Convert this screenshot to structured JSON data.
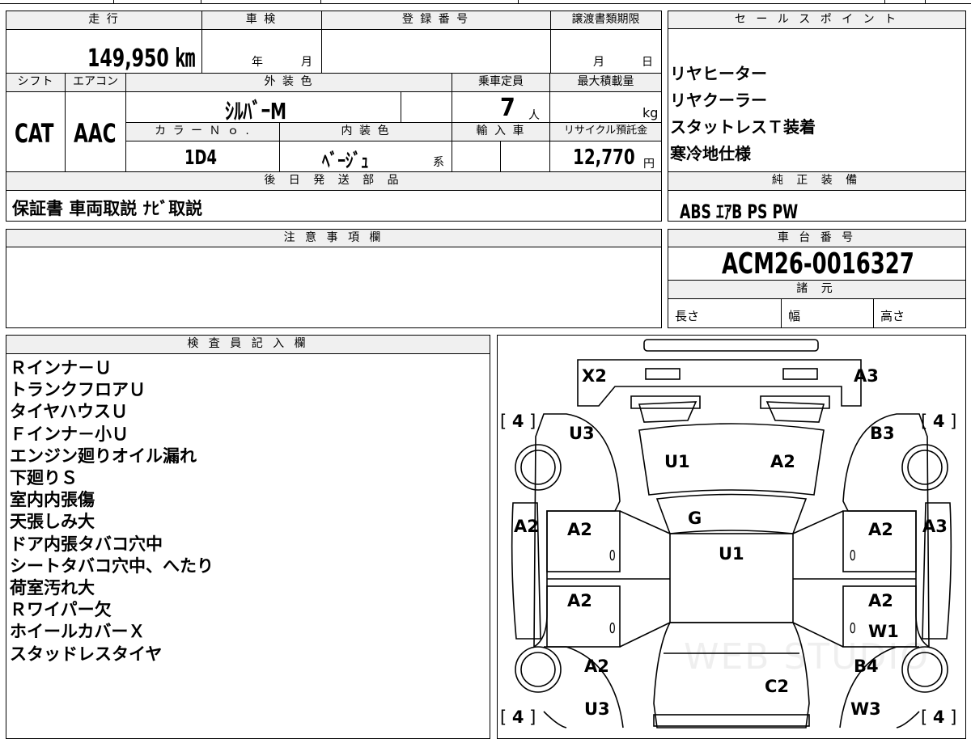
{
  "top_info": {
    "mileage_label": "走 行",
    "mileage": "149,950 ㎞",
    "inspection_label": "車 検",
    "inspection_year": "年",
    "inspection_month": "月",
    "registration_label": "登 録 番 号",
    "transfer_label": "譲渡書類期限",
    "transfer_month": "月",
    "transfer_day": "日",
    "shift_label": "シフト",
    "shift": "CAT",
    "ac_label": "エアコン",
    "ac": "AAC",
    "exterior_label": "外 装 色",
    "exterior": "ｼﾙﾊﾞｰM",
    "capacity_label": "乗車定員",
    "capacity": "7",
    "capacity_unit": "人",
    "max_load_label": "最大積載量",
    "max_load_unit": "kg",
    "color_no_label": "カ ラ ー Ｎ ｏ .",
    "color_no": "1D4",
    "interior_label": "内 装 色",
    "interior": "ﾍﾞｰｼﾞｭ",
    "interior_suffix": "系",
    "import_label": "輸 入 車",
    "recycle_label": "リサイクル預託金",
    "recycle": "12,770",
    "recycle_unit": "円",
    "later_parts_label": "後 日 発 送 部 品",
    "later_parts": "保証書 車両取説 ﾅﾋﾞ取説"
  },
  "sales_points": {
    "label": "セ ー ル ス ポ イ ン ト",
    "items": [
      "リヤヒーター",
      "リヤクーラー",
      "スタットレスＴ装着",
      "寒冷地仕様"
    ]
  },
  "equipment": {
    "label": "純 正 装 備",
    "value": "ABS ｴｱB PS PW"
  },
  "notes": {
    "label": "注 意 事 項 欄"
  },
  "chassis": {
    "label": "車 台 番 号",
    "value": "ACM26-0016327",
    "spec_label": "諸 元",
    "length": "長さ",
    "width": "幅",
    "height": "高さ"
  },
  "inspector": {
    "label": "検 査 員 記 入 欄",
    "lines": [
      "Ｒインナ－Ｕ",
      "トランクフロアＵ",
      "タイヤハウスＵ",
      "Ｆインナ－小Ｕ",
      "エンジン廻りオイル漏れ",
      "下廻りＳ",
      "室内内張傷",
      "天張しみ大",
      "ドア内張タバコ穴中",
      "シートタバコ穴中、へたり",
      "荷室汚れ大",
      "Ｒワイパー欠",
      "ホイールカバーＸ",
      "スタッドレスタイヤ"
    ]
  },
  "diagram": {
    "tire_depth": "4",
    "watermark": "WEB STUDIO",
    "marks": {
      "x2": "X2",
      "a3_top": "A3",
      "u3_left": "U3",
      "b3": "B3",
      "u1_hood": "U1",
      "a2_hood": "A2",
      "g": "G",
      "u1_roof": "U1",
      "a2_left_fender": "A2",
      "a3_right_fender": "A3",
      "a2_fl_door": "A2",
      "a2_fr_door": "A2",
      "a2_rl_door": "A2",
      "a2_rr_door": "A2",
      "w1": "W1",
      "a2_rl_quarter": "A2",
      "b4": "B4",
      "c2": "C2",
      "u3_bottom": "U3",
      "w3": "W3",
      "zero": "0"
    }
  }
}
